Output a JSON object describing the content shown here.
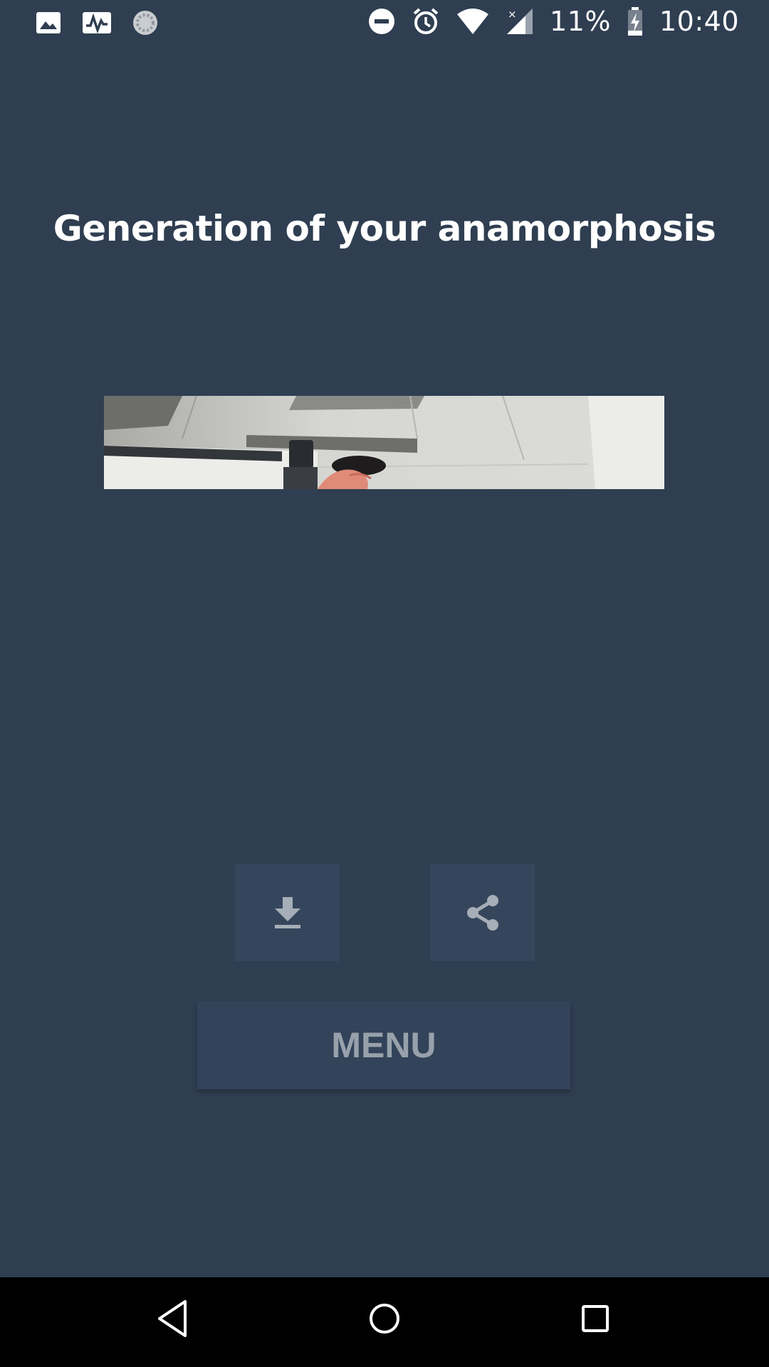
{
  "status_bar": {
    "battery_percent": "11%",
    "time": "10:40",
    "icons": [
      "image-icon",
      "activity-icon",
      "sync-spinner-icon",
      "do-not-disturb-icon",
      "alarm-icon",
      "wifi-icon",
      "signal-icon",
      "battery-charging-icon"
    ]
  },
  "page": {
    "title": "Generation of your anamorphosis"
  },
  "actions": {
    "download_icon": "download-icon",
    "share_icon": "share-icon",
    "menu_label": "MENU"
  },
  "nav_bar": {
    "icons": [
      "back-icon",
      "home-icon",
      "recents-icon"
    ]
  },
  "colors": {
    "background": "#2f3e51",
    "button": "#35465c",
    "menu_text": "#98a1ab"
  }
}
